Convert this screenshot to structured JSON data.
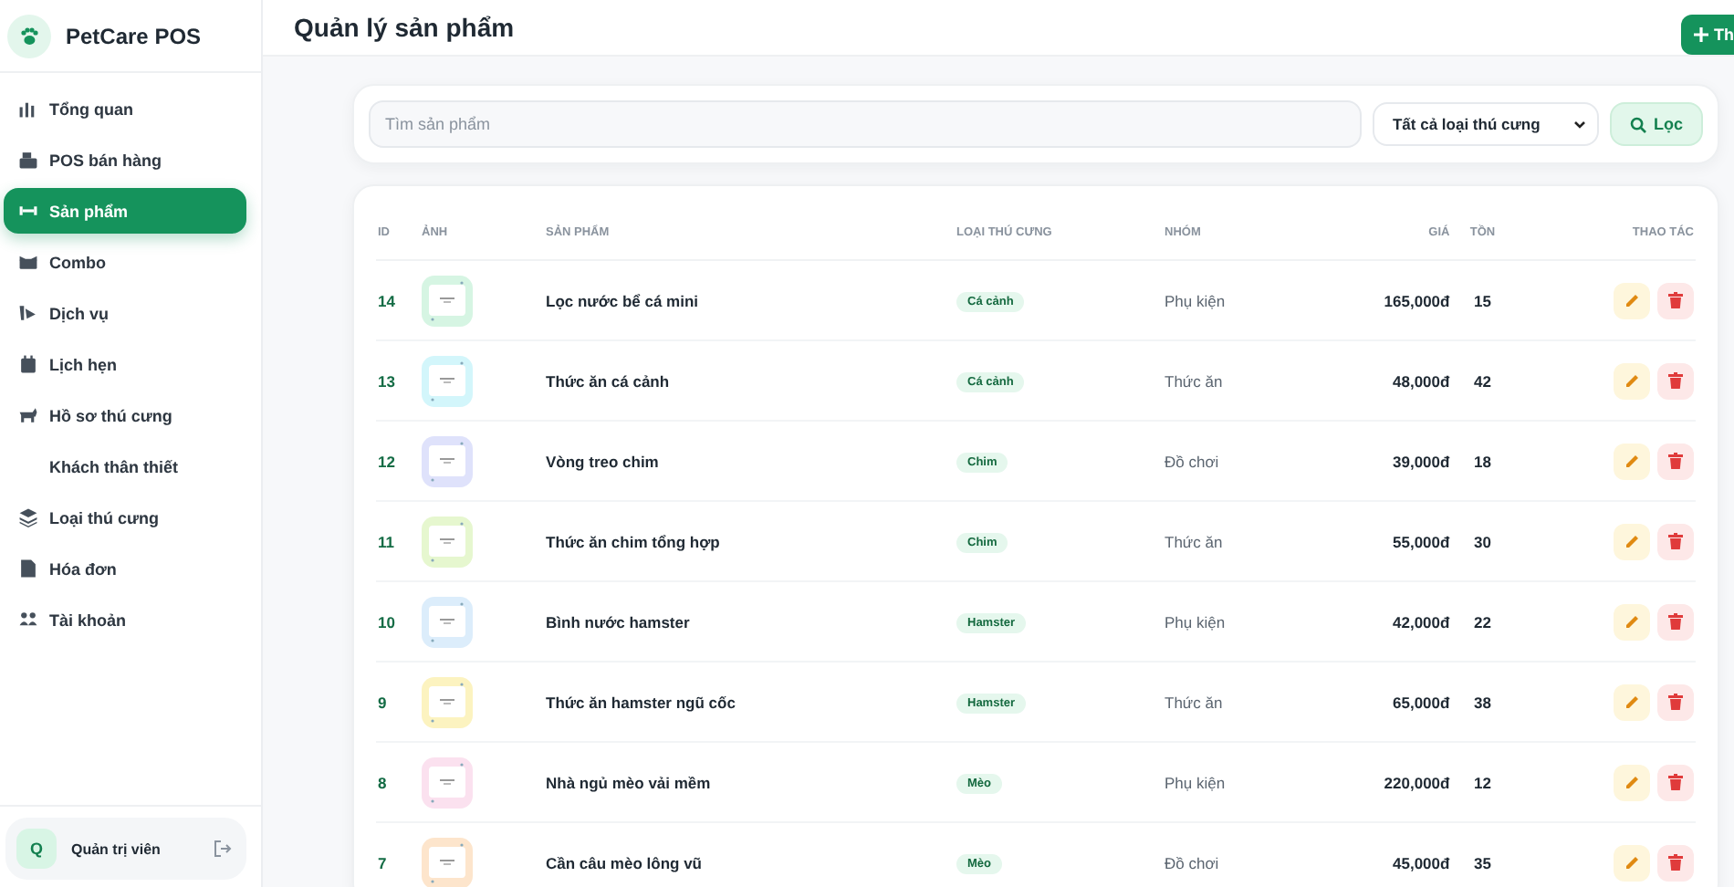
{
  "brand": {
    "name": "PetCare POS"
  },
  "sidebar": {
    "items": [
      {
        "label": "Tổng quan",
        "selected": false
      },
      {
        "label": "POS bán hàng",
        "selected": false
      },
      {
        "label": "Sản phẩm",
        "selected": true
      },
      {
        "label": "Combo",
        "selected": false
      },
      {
        "label": "Dịch vụ",
        "selected": false
      },
      {
        "label": "Lịch hẹn",
        "selected": false
      },
      {
        "label": "Hồ sơ thú cưng",
        "selected": false
      },
      {
        "label": "Khách thân thiết",
        "selected": false
      },
      {
        "label": "Loại thú cưng",
        "selected": false
      },
      {
        "label": "Hóa đơn",
        "selected": false
      },
      {
        "label": "Tài khoản",
        "selected": false
      }
    ],
    "user": {
      "initial": "Q",
      "name": "Quản trị viên"
    }
  },
  "header": {
    "title": "Quản lý sản phẩm",
    "add_button": "Th"
  },
  "filters": {
    "search": {
      "placeholder": "Tìm sản phẩm"
    },
    "pet_type": "Tất cả loại thú cưng",
    "filter_button": "Lọc"
  },
  "table": {
    "columns": [
      "ID",
      "ẢNH",
      "SẢN PHẨM",
      "LOẠI THÚ CƯNG",
      "NHÓM",
      "GIÁ",
      "TỒN",
      "THAO TÁC"
    ],
    "rows": [
      {
        "id": "14",
        "name": "Lọc nước bể cá mini",
        "pet_type": "Cá cảnh",
        "group": "Phụ kiện",
        "price": "165,000đ",
        "stock": "15"
      },
      {
        "id": "13",
        "name": "Thức ăn cá cảnh",
        "pet_type": "Cá cảnh",
        "group": "Thức ăn",
        "price": "48,000đ",
        "stock": "42"
      },
      {
        "id": "12",
        "name": "Vòng treo chim",
        "pet_type": "Chim",
        "group": "Đồ chơi",
        "price": "39,000đ",
        "stock": "18"
      },
      {
        "id": "11",
        "name": "Thức ăn chim tổng hợp",
        "pet_type": "Chim",
        "group": "Thức ăn",
        "price": "55,000đ",
        "stock": "30"
      },
      {
        "id": "10",
        "name": "Bình nước hamster",
        "pet_type": "Hamster",
        "group": "Phụ kiện",
        "price": "42,000đ",
        "stock": "22"
      },
      {
        "id": "9",
        "name": "Thức ăn hamster ngũ cốc",
        "pet_type": "Hamster",
        "group": "Thức ăn",
        "price": "65,000đ",
        "stock": "38"
      },
      {
        "id": "8",
        "name": "Nhà ngủ mèo vải mềm",
        "pet_type": "Mèo",
        "group": "Phụ kiện",
        "price": "220,000đ",
        "stock": "12"
      },
      {
        "id": "7",
        "name": "Cần câu mèo lông vũ",
        "pet_type": "Mèo",
        "group": "Đồ chơi",
        "price": "45,000đ",
        "stock": "35"
      }
    ]
  }
}
